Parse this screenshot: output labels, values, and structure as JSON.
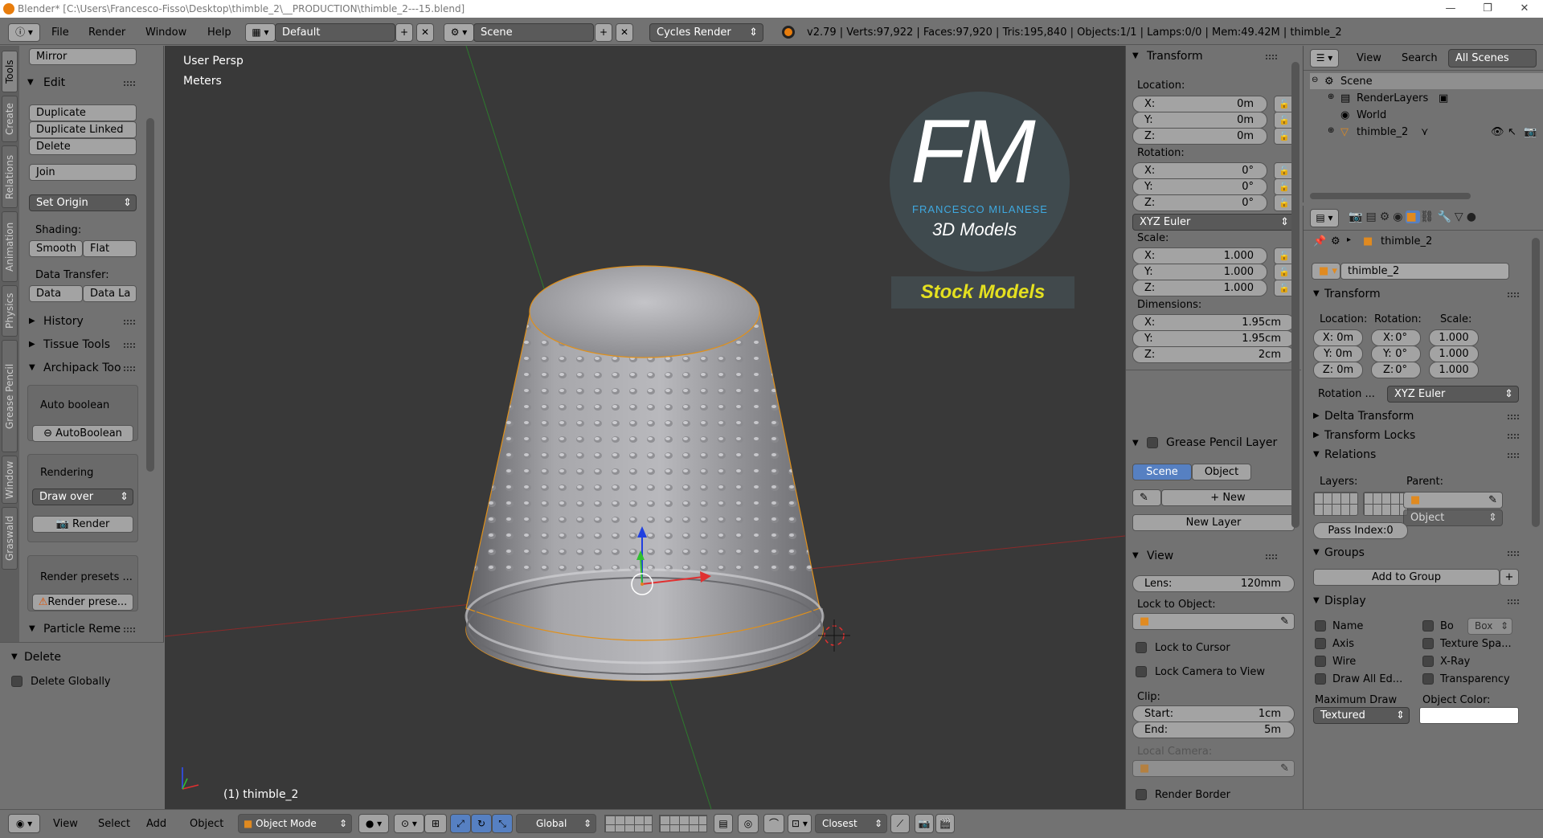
{
  "window": {
    "title": "Blender* [C:\\Users\\Francesco-Fisso\\Desktop\\thimble_2\\__PRODUCTION\\thimble_2---15.blend]",
    "minimize": "—",
    "maximize": "❐",
    "close": "✕"
  },
  "header": {
    "menus": [
      "File",
      "Render",
      "Window",
      "Help"
    ],
    "layout": "Default",
    "scene": "Scene",
    "engine": "Cycles Render",
    "stats": "v2.79 | Verts:97,922 | Faces:97,920 | Tris:195,840 | Objects:1/1 | Lamps:0/0 | Mem:49.42M | thimble_2"
  },
  "side_tabs": [
    "Tools",
    "Create",
    "Relations",
    "Animation",
    "Physics",
    "Grease Pencil",
    "Window",
    "Graswald"
  ],
  "tools": {
    "mirror": "Mirror",
    "edit_title": "Edit",
    "duplicate": "Duplicate",
    "duplicate_linked": "Duplicate Linked",
    "delete": "Delete",
    "join": "Join",
    "set_origin": "Set Origin",
    "shading_label": "Shading:",
    "smooth": "Smooth",
    "flat": "Flat",
    "data_transfer_label": "Data Transfer:",
    "data": "Data",
    "data_la": "Data La",
    "history": "History",
    "tissue": "Tissue Tools",
    "archipack": "Archipack Too",
    "auto_boolean_label": "Auto boolean",
    "autoboolean_btn": "AutoBoolean",
    "rendering_label": "Rendering",
    "draw_over": "Draw over",
    "render_btn": "Render",
    "render_presets_label": "Render presets ...",
    "render_presets_btn": "Render prese...",
    "particle": "Particle Reme",
    "delete_title": "Delete",
    "delete_globally": "Delete Globally"
  },
  "viewport": {
    "view_name": "User Persp",
    "units": "Meters",
    "object_label": "(1) thimble_2",
    "logo_letters": "FM",
    "logo_name": "FRANCESCO MILANESE",
    "logo_sub": "3D Models",
    "logo_banner": "Stock Models"
  },
  "npanel": {
    "transform_title": "Transform",
    "location_label": "Location:",
    "location": [
      {
        "axis": "X:",
        "val": "0m"
      },
      {
        "axis": "Y:",
        "val": "0m"
      },
      {
        "axis": "Z:",
        "val": "0m"
      }
    ],
    "rotation_label": "Rotation:",
    "rotation": [
      {
        "axis": "X:",
        "val": "0°"
      },
      {
        "axis": "Y:",
        "val": "0°"
      },
      {
        "axis": "Z:",
        "val": "0°"
      }
    ],
    "rotation_mode": "XYZ Euler",
    "scale_label": "Scale:",
    "scale": [
      {
        "axis": "X:",
        "val": "1.000"
      },
      {
        "axis": "Y:",
        "val": "1.000"
      },
      {
        "axis": "Z:",
        "val": "1.000"
      }
    ],
    "dimensions_label": "Dimensions:",
    "dimensions": [
      {
        "axis": "X:",
        "val": "1.95cm"
      },
      {
        "axis": "Y:",
        "val": "1.95cm"
      },
      {
        "axis": "Z:",
        "val": "2cm"
      }
    ],
    "gp_title": "Grease Pencil Layer",
    "gp_scene": "Scene",
    "gp_object": "Object",
    "gp_new": "New",
    "gp_new_layer": "New Layer",
    "view_title": "View",
    "lens_label": "Lens:",
    "lens_val": "120mm",
    "lock_to_object": "Lock to Object:",
    "lock_cursor": "Lock to Cursor",
    "lock_camera": "Lock Camera to View",
    "clip_label": "Clip:",
    "clip_start_label": "Start:",
    "clip_start": "1cm",
    "clip_end_label": "End:",
    "clip_end": "5m",
    "local_camera": "Local Camera:",
    "render_border": "Render Border"
  },
  "outliner": {
    "view": "View",
    "search": "Search",
    "filter": "All Scenes",
    "items": [
      {
        "label": "Scene"
      },
      {
        "label": "RenderLayers"
      },
      {
        "label": "World"
      },
      {
        "label": "thimble_2"
      }
    ]
  },
  "properties": {
    "breadcrumb": "thimble_2",
    "object_name": "thimble_2",
    "transform_title": "Transform",
    "location_label": "Location:",
    "rotation_label": "Rotation:",
    "scale_label": "Scale:",
    "loc": [
      "X: 0m",
      "Y: 0m",
      "Z: 0m"
    ],
    "rot_axes": [
      "X:",
      "Y:",
      "Z:"
    ],
    "rot_vals": [
      "0°",
      "0°",
      "0°"
    ],
    "scl": [
      "1.000",
      "1.000",
      "1.000"
    ],
    "rotation_mode_label": "Rotation ...",
    "rotation_mode": "XYZ Euler",
    "delta_transform": "Delta Transform",
    "transform_locks": "Transform Locks",
    "relations_title": "Relations",
    "layers_label": "Layers:",
    "parent_label": "Parent:",
    "parent_type": "Object",
    "pass_index": "Pass Index:0",
    "groups_title": "Groups",
    "add_to_group": "Add to Group",
    "display_title": "Display",
    "disp_left": [
      "Name",
      "Axis",
      "Wire",
      "Draw All Ed..."
    ],
    "disp_right": [
      "Bo",
      "Texture Spa...",
      "X-Ray",
      "Transparency"
    ],
    "bounds_type": "Box",
    "max_draw_label": "Maximum Draw",
    "max_draw_value": "Textured",
    "object_color_label": "Object Color:"
  },
  "footer": {
    "view": "View",
    "select": "Select",
    "add": "Add",
    "object": "Object",
    "mode": "Object Mode",
    "orientation": "Global",
    "snap": "Closest"
  }
}
